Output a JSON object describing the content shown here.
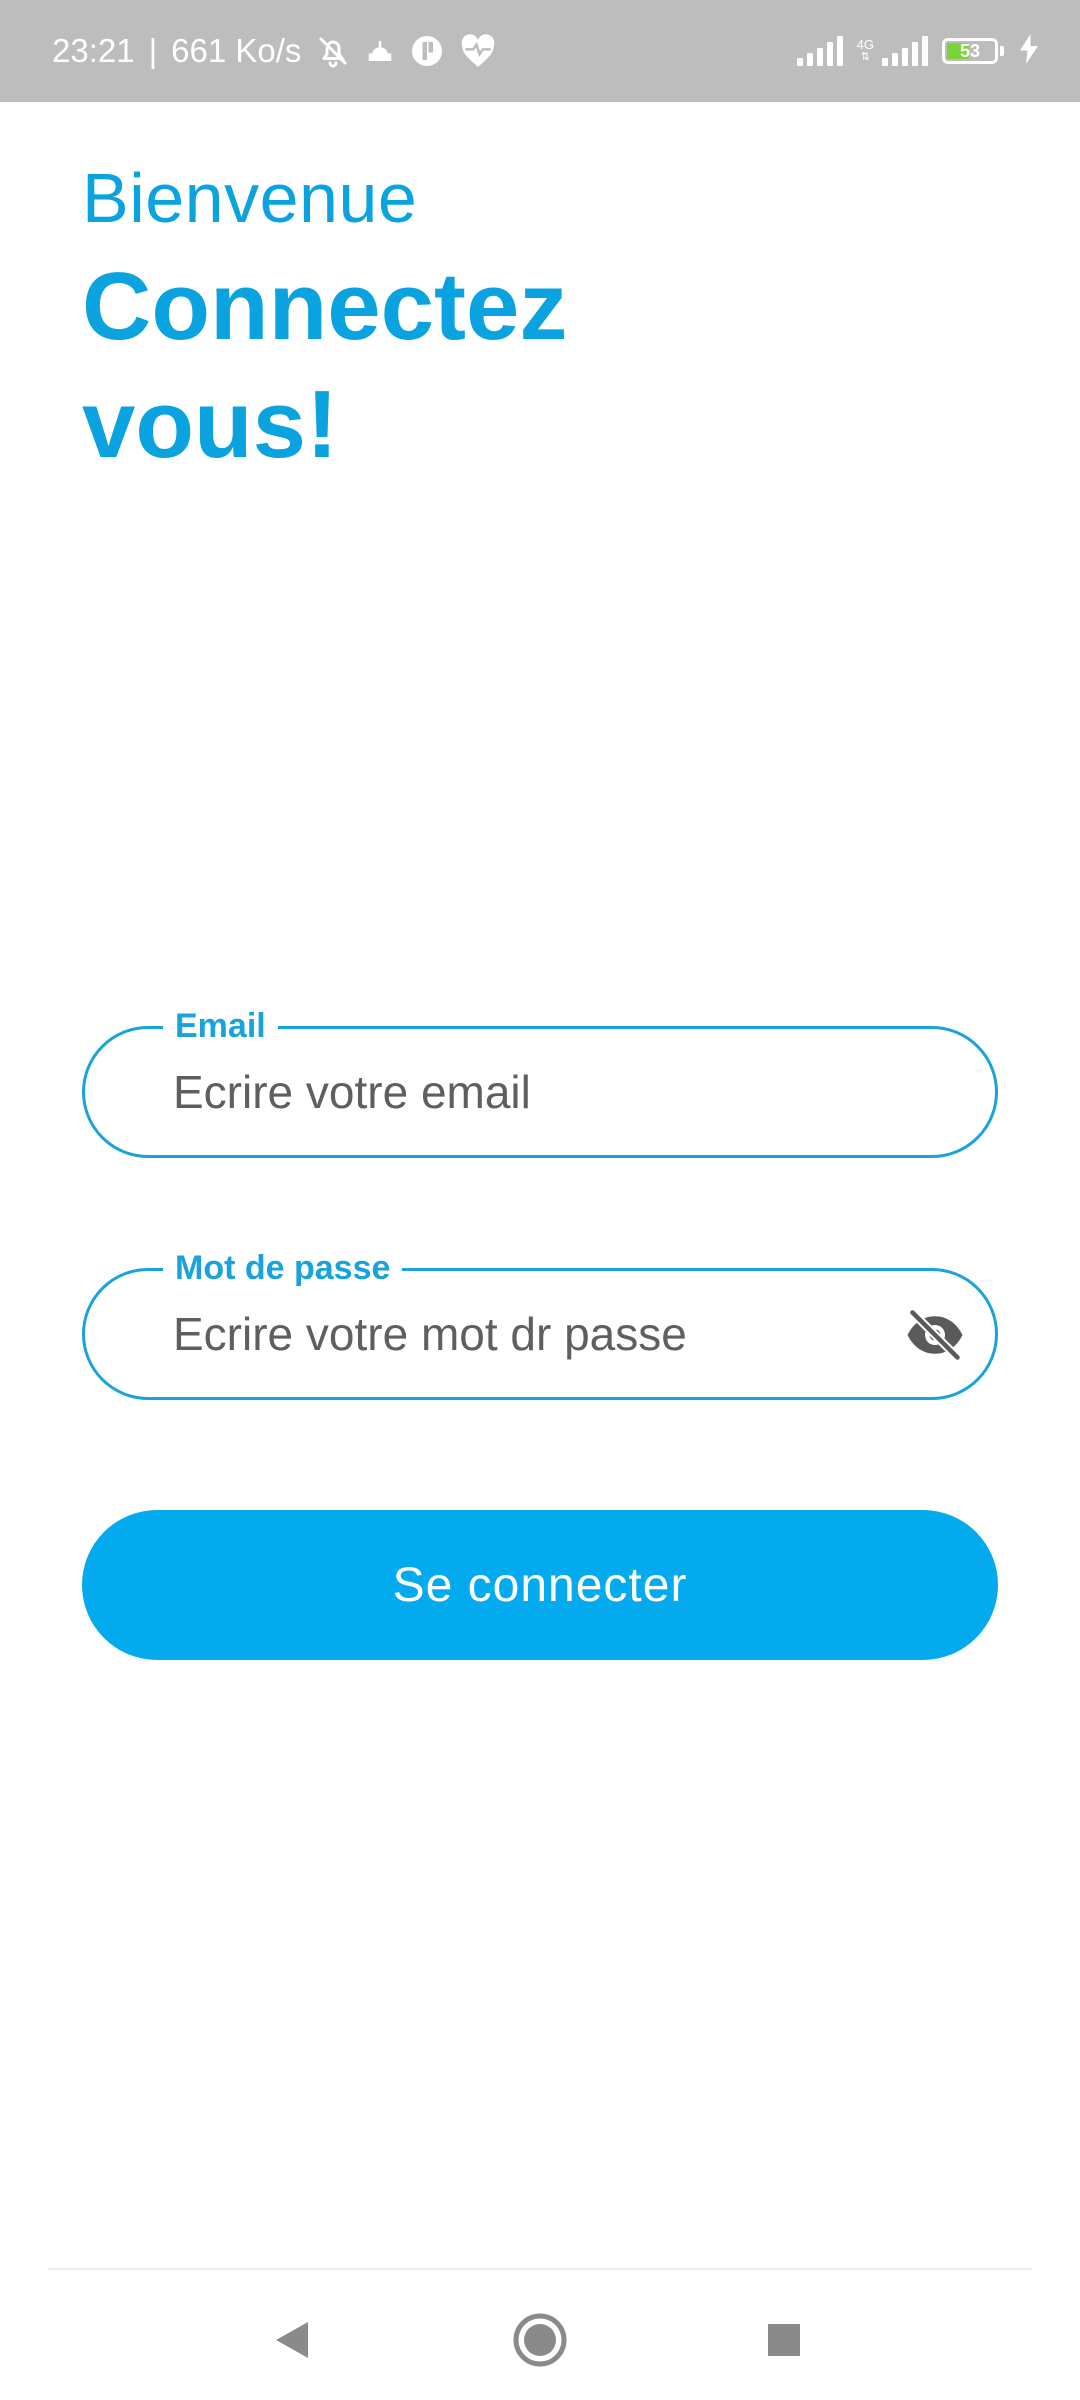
{
  "status_bar": {
    "time": "23:21",
    "separator": "|",
    "speed": "661 Ko/s",
    "network_type": "4G",
    "battery_level": "53",
    "battery_fill_percent": 53,
    "icons": [
      "mute-bell-icon",
      "mosque-icon",
      "circle-app-icon",
      "heart-pulse-icon",
      "signal-icon",
      "signal-4g-icon",
      "battery-icon",
      "charging-icon"
    ]
  },
  "header": {
    "welcome": "Bienvenue",
    "title": "Connectez vous!"
  },
  "form": {
    "email": {
      "label": "Email",
      "placeholder": "Ecrire votre email",
      "value": ""
    },
    "password": {
      "label": "Mot de passe",
      "placeholder": "Ecrire votre mot dr passe",
      "value": "",
      "toggle_icon": "eye-off-icon"
    },
    "submit_label": "Se connecter"
  },
  "nav": {
    "icons": [
      "back-icon",
      "home-icon",
      "recents-icon"
    ]
  },
  "colors": {
    "accent": "#0aa3df",
    "button": "#03abee",
    "status_bar": "#bdbdbd",
    "battery_fill": "#7bd23a"
  }
}
